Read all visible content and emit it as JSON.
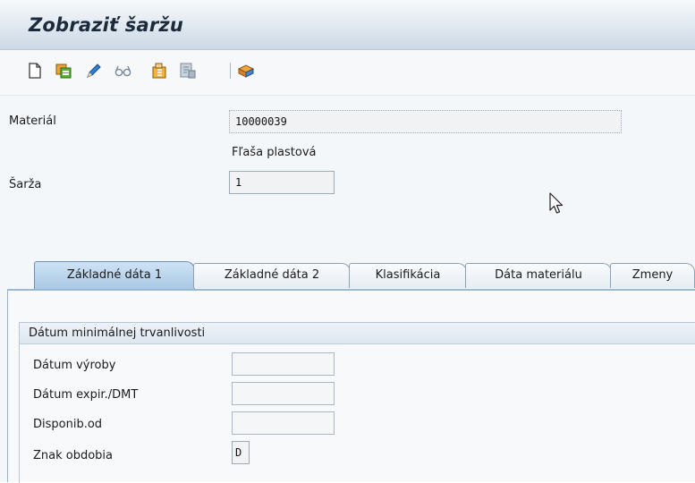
{
  "window": {
    "title": "Zobraziť šaržu"
  },
  "toolbar": {
    "icons": [
      "new-document-icon",
      "copy-icon",
      "change-pencil-icon",
      "display-glasses-icon",
      "other-object-icon",
      "print-preview-icon",
      "classification-icon"
    ]
  },
  "header": {
    "material_label": "Materiál",
    "material_value": "10000039",
    "material_description": "Fľaša plastová",
    "batch_label": "Šarža",
    "batch_value": "1"
  },
  "tabs": [
    {
      "label": "Základné dáta 1",
      "active": true
    },
    {
      "label": "Základné dáta 2",
      "active": false
    },
    {
      "label": "Klasifikácia",
      "active": false
    },
    {
      "label": "Dáta materiálu",
      "active": false
    },
    {
      "label": "Zmeny",
      "active": false
    }
  ],
  "shelf_life_group": {
    "title": "Dátum minimálnej trvanlivosti",
    "production_date_label": "Dátum výroby",
    "production_date_value": "",
    "expiry_date_label": "Dátum expir./DMT",
    "expiry_date_value": "",
    "available_from_label": "Disponib.od",
    "available_from_value": "",
    "period_indicator_label": "Znak obdobia",
    "period_indicator_value": "D"
  },
  "colors": {
    "title_text": "#1c2a3a",
    "active_tab": "#a9c9e6",
    "field_border": "#9ea9b4",
    "background": "#f4f7fa"
  }
}
